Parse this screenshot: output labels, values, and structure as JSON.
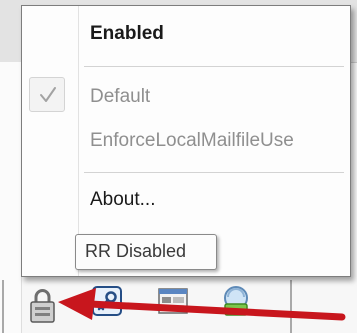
{
  "context_menu": {
    "items": [
      {
        "label": "Enabled",
        "style": "bold",
        "checked": false
      },
      {
        "label": "Default",
        "style": "disabled",
        "checked": true
      },
      {
        "label": "EnforceLocalMailfileUse",
        "style": "disabled",
        "checked": false
      },
      {
        "label": "About...",
        "style": "normal",
        "checked": false
      }
    ]
  },
  "tooltip": {
    "text": "RR Disabled"
  },
  "status_bar": {
    "icons": [
      "lock-icon",
      "key-icon",
      "window-icon",
      "replication-icon"
    ]
  },
  "annotation": {
    "arrow_color": "#c8161d"
  }
}
